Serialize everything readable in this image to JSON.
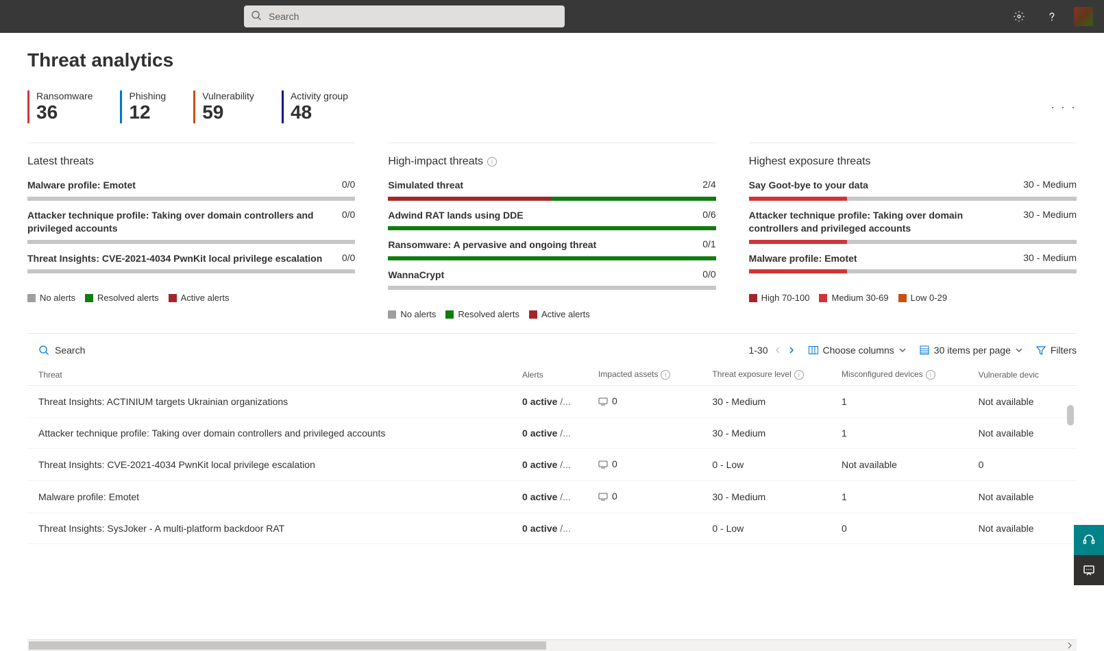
{
  "header": {
    "search_placeholder": "Search"
  },
  "page": {
    "title": "Threat analytics"
  },
  "stats": [
    {
      "label": "Ransomware",
      "value": "36",
      "color": "#d13438"
    },
    {
      "label": "Phishing",
      "value": "12",
      "color": "#0078d4"
    },
    {
      "label": "Vulnerability",
      "value": "59",
      "color": "#ca5010"
    },
    {
      "label": "Activity group",
      "value": "48",
      "color": "#00188f"
    }
  ],
  "colors": {
    "no_alerts": "#a19f9d",
    "resolved": "#107c10",
    "active": "#a4262c",
    "high": "#a4262c",
    "medium": "#d13438",
    "low": "#ca5010"
  },
  "cards": {
    "latest": {
      "title": "Latest threats",
      "items": [
        {
          "name": "Malware profile: Emotet",
          "metric": "0/0",
          "segments": []
        },
        {
          "name": "Attacker technique profile: Taking over domain controllers and privileged accounts",
          "metric": "0/0",
          "segments": []
        },
        {
          "name": "Threat Insights: CVE-2021-4034 PwnKit local privilege escalation",
          "metric": "0/0",
          "segments": []
        }
      ],
      "legend": [
        {
          "label": "No alerts",
          "color": "#a19f9d"
        },
        {
          "label": "Resolved alerts",
          "color": "#107c10"
        },
        {
          "label": "Active alerts",
          "color": "#a4262c"
        }
      ]
    },
    "high_impact": {
      "title": "High-impact threats",
      "items": [
        {
          "name": "Simulated threat",
          "metric": "2/4",
          "segments": [
            {
              "color": "#a4262c",
              "pct": 50
            },
            {
              "color": "#107c10",
              "pct": 50
            }
          ]
        },
        {
          "name": "Adwind RAT lands using DDE",
          "metric": "0/6",
          "segments": [
            {
              "color": "#107c10",
              "pct": 100
            }
          ]
        },
        {
          "name": "Ransomware: A pervasive and ongoing threat",
          "metric": "0/1",
          "segments": [
            {
              "color": "#107c10",
              "pct": 100
            }
          ]
        },
        {
          "name": "WannaCrypt",
          "metric": "0/0",
          "segments": []
        }
      ],
      "legend": [
        {
          "label": "No alerts",
          "color": "#a19f9d"
        },
        {
          "label": "Resolved alerts",
          "color": "#107c10"
        },
        {
          "label": "Active alerts",
          "color": "#a4262c"
        }
      ]
    },
    "highest_exposure": {
      "title": "Highest exposure threats",
      "items": [
        {
          "name": "Say Goot-bye to your data",
          "metric": "30 - Medium",
          "segments": [
            {
              "color": "#d13438",
              "pct": 30
            }
          ]
        },
        {
          "name": "Attacker technique profile: Taking over domain controllers and privileged accounts",
          "metric": "30 - Medium",
          "segments": [
            {
              "color": "#d13438",
              "pct": 30
            }
          ]
        },
        {
          "name": "Malware profile: Emotet",
          "metric": "30 - Medium",
          "segments": [
            {
              "color": "#d13438",
              "pct": 30
            }
          ]
        }
      ],
      "legend": [
        {
          "label": "High 70-100",
          "color": "#a4262c"
        },
        {
          "label": "Medium 30-69",
          "color": "#d13438"
        },
        {
          "label": "Low 0-29",
          "color": "#ca5010"
        }
      ]
    }
  },
  "table": {
    "search_label": "Search",
    "pager_text": "1-30",
    "choose_columns": "Choose columns",
    "items_per_page": "30 items per page",
    "filters": "Filters",
    "columns": {
      "threat": "Threat",
      "alerts": "Alerts",
      "impacted": "Impacted assets",
      "exposure": "Threat exposure level",
      "misconfig": "Misconfigured devices",
      "vuln": "Vulnerable devic"
    },
    "rows": [
      {
        "threat": "Threat Insights: ACTINIUM targets Ukrainian organizations",
        "alerts_active": "0 active",
        "alerts_rest": " /...",
        "impacted": "0",
        "show_device": true,
        "exposure": "30 - Medium",
        "misconfig": "1",
        "vuln": "Not available"
      },
      {
        "threat": "Attacker technique profile: Taking over domain controllers and privileged accounts",
        "alerts_active": "0 active",
        "alerts_rest": " /...",
        "impacted": "",
        "show_device": false,
        "exposure": "30 - Medium",
        "misconfig": "1",
        "vuln": "Not available"
      },
      {
        "threat": "Threat Insights: CVE-2021-4034 PwnKit local privilege escalation",
        "alerts_active": "0 active",
        "alerts_rest": " /...",
        "impacted": "0",
        "show_device": true,
        "exposure": "0 - Low",
        "misconfig": "Not available",
        "vuln": "0"
      },
      {
        "threat": "Malware profile: Emotet",
        "alerts_active": "0 active",
        "alerts_rest": " /...",
        "impacted": "0",
        "show_device": true,
        "exposure": "30 - Medium",
        "misconfig": "1",
        "vuln": "Not available"
      },
      {
        "threat": "Threat Insights: SysJoker - A multi-platform backdoor RAT",
        "alerts_active": "0 active",
        "alerts_rest": " /...",
        "impacted": "",
        "show_device": false,
        "exposure": "0 - Low",
        "misconfig": "0",
        "vuln": "Not available"
      }
    ]
  }
}
